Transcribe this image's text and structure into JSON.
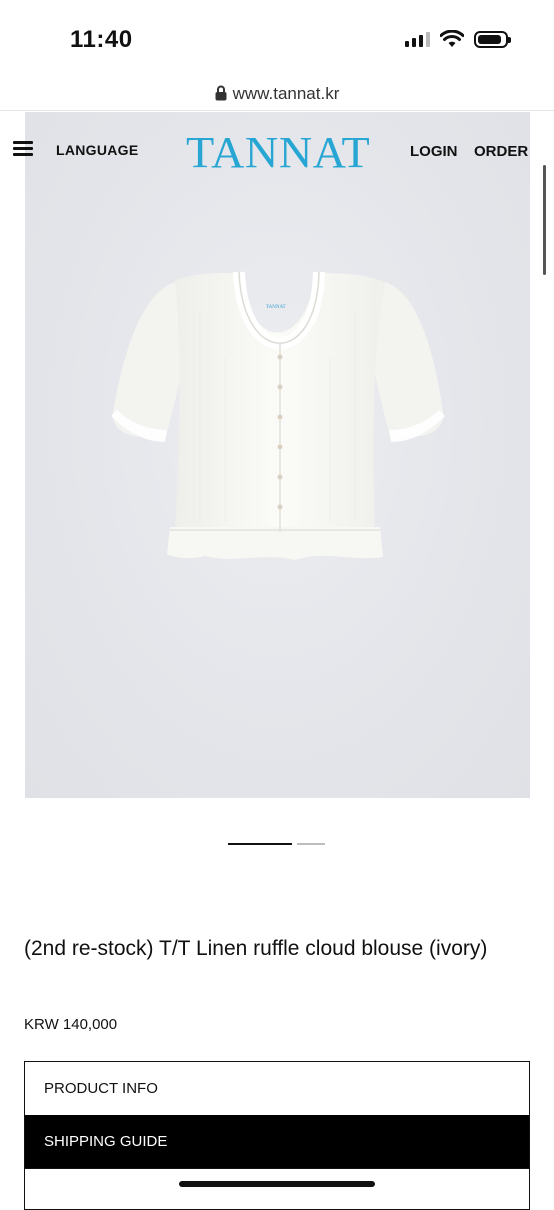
{
  "status_bar": {
    "time": "11:40"
  },
  "browser": {
    "url": "www.tannat.kr"
  },
  "header": {
    "language": "LANGUAGE",
    "logo": "TANNAT",
    "login": "LOGIN",
    "order": "ORDER"
  },
  "product": {
    "title": "(2nd re-stock) T/T Linen ruffle cloud blouse (ivory)",
    "price": "KRW 140,000",
    "image_label": "TANNAT"
  },
  "tabs": [
    {
      "label": "PRODUCT INFO",
      "active": false
    },
    {
      "label": "SHIPPING GUIDE",
      "active": true
    }
  ],
  "colors": {
    "brand": "#27a6d3",
    "image_bg": "#e1e3e8"
  }
}
